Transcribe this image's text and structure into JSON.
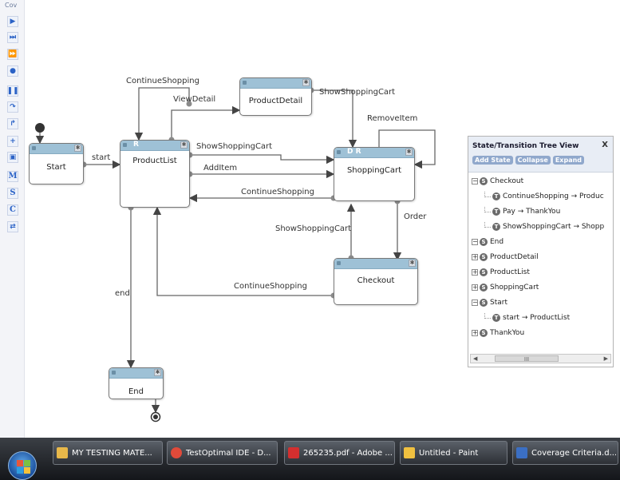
{
  "toolbar": {
    "label": "Cov",
    "buttons": [
      "play-icon",
      "step-forward-icon",
      "fast-forward-icon",
      "record-icon",
      "pause-icon",
      "step-into-icon",
      "step-over-icon",
      "add-icon",
      "snapshot-icon",
      "M",
      "S",
      "C",
      "swap-icon"
    ]
  },
  "diagram": {
    "states": [
      {
        "id": "start",
        "name": "Start",
        "flags": ""
      },
      {
        "id": "productlist",
        "name": "ProductList",
        "flags": "R"
      },
      {
        "id": "productdetail",
        "name": "ProductDetail",
        "flags": ""
      },
      {
        "id": "shoppingcart",
        "name": "ShoppingCart",
        "flags": "D R"
      },
      {
        "id": "checkout",
        "name": "Checkout",
        "flags": ""
      },
      {
        "id": "end",
        "name": "End",
        "flags": ""
      }
    ],
    "transitions": {
      "start": "start",
      "continue_top": "ContinueShopping",
      "viewdetail": "ViewDetail",
      "showcart_top": "ShowShoppingCart",
      "removeitem": "RemoveItem",
      "showcart_mid": "ShowShoppingCart",
      "additem": "AddItem",
      "continue_mid": "ContinueShopping",
      "order": "Order",
      "showcart_low": "ShowShoppingCart",
      "continue_low": "ContinueShopping",
      "end": "end"
    }
  },
  "tree_panel": {
    "title": "State/Transition Tree View",
    "close": "X",
    "buttons": {
      "add_state": "Add State",
      "collapse": "Collapse",
      "expand": "Expand"
    },
    "rows": [
      {
        "type": "state",
        "expander": "minus",
        "icon": "S",
        "label": "Checkout",
        "indent": 0
      },
      {
        "type": "transition",
        "icon": "T",
        "label": "ContinueShopping → Produc",
        "indent": 1
      },
      {
        "type": "transition",
        "icon": "T",
        "label": "Pay → ThankYou",
        "indent": 1
      },
      {
        "type": "transition",
        "icon": "T",
        "label": "ShowShoppingCart → Shopp",
        "indent": 1
      },
      {
        "type": "state",
        "expander": "minus",
        "icon": "S",
        "label": "End",
        "indent": 0
      },
      {
        "type": "state",
        "expander": "plus",
        "icon": "S",
        "label": "ProductDetail",
        "indent": 0
      },
      {
        "type": "state",
        "expander": "plus",
        "icon": "S",
        "label": "ProductList",
        "indent": 0
      },
      {
        "type": "state",
        "expander": "plus",
        "icon": "S",
        "label": "ShoppingCart",
        "indent": 0
      },
      {
        "type": "state",
        "expander": "minus",
        "icon": "S",
        "label": "Start",
        "indent": 0
      },
      {
        "type": "transition",
        "icon": "T",
        "label": "start → ProductList",
        "indent": 1
      },
      {
        "type": "state",
        "expander": "plus",
        "icon": "S",
        "label": "ThankYou",
        "indent": 0
      }
    ],
    "scroll_thumb": "III"
  },
  "taskbar": {
    "items": [
      {
        "label": "MY TESTING MATE...",
        "icon": "folder-icon",
        "color": "#e8b84a"
      },
      {
        "label": "TestOptimal IDE - D...",
        "icon": "chrome-icon",
        "color": "#e04a3a"
      },
      {
        "label": "265235.pdf - Adobe ...",
        "icon": "pdf-icon",
        "color": "#d32f2f"
      },
      {
        "label": "Untitled - Paint",
        "icon": "paint-icon",
        "color": "#f0c040"
      },
      {
        "label": "Coverage Criteria.d...",
        "icon": "word-icon",
        "color": "#3b6fc4"
      }
    ]
  }
}
